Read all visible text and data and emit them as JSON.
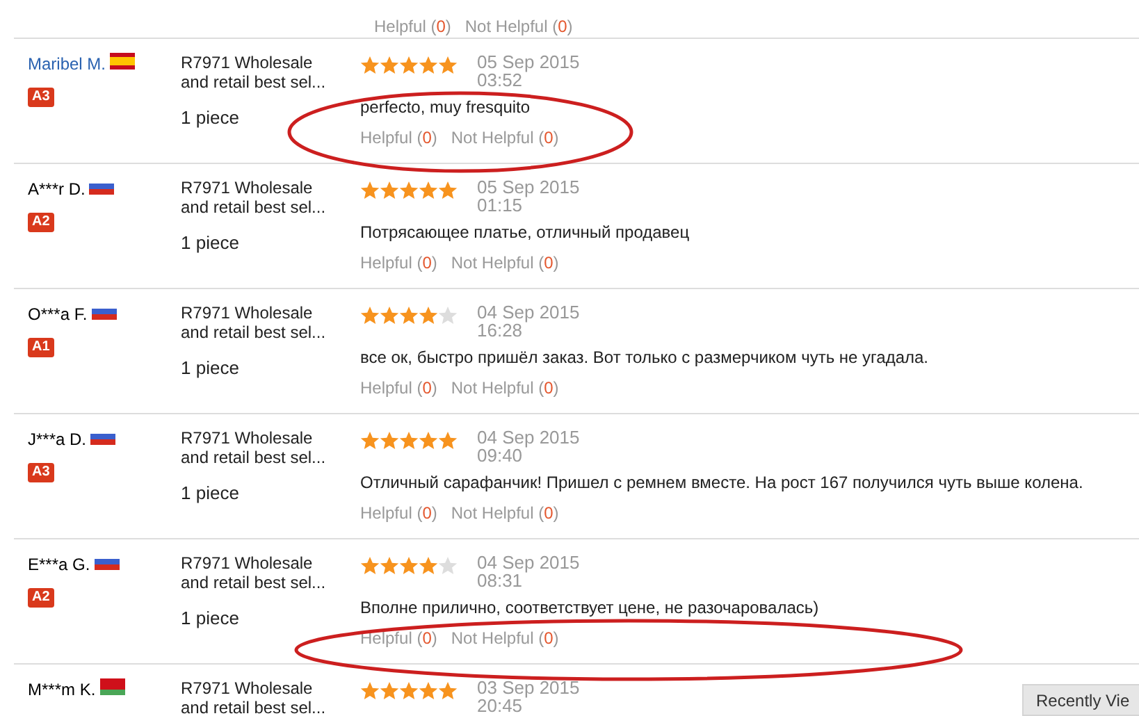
{
  "top_review": {
    "helpful": "Helpful",
    "helpful_count": "(0)",
    "not_helpful": "Not Helpful",
    "not_helpful_count": "(0)"
  },
  "reviews": [
    {
      "name": "Maribel M.",
      "kind": "link",
      "flag": {
        "kind": "es"
      },
      "badge": "A3",
      "product": "R7971 Wholesale and retail best sel...",
      "quantity": "1 piece",
      "stars": 5,
      "date": "05 Sep 2015",
      "time": "03:52",
      "text": "perfecto, muy fresquito",
      "helpful": "Helpful",
      "helpful_count": "(0)",
      "not_helpful": "Not Helpful",
      "not_helpful_count": "(0)",
      "circled": true
    },
    {
      "name": "A***r D.",
      "kind": "plain",
      "flag": {
        "kind": "ru"
      },
      "badge": "A2",
      "product": "R7971 Wholesale and retail best sel...",
      "quantity": "1 piece",
      "stars": 5,
      "date": "05 Sep 2015",
      "time": "01:15",
      "text": "Потрясающее платье, отличный продавец",
      "helpful": "Helpful",
      "helpful_count": "(0)",
      "not_helpful": "Not Helpful",
      "not_helpful_count": "(0)",
      "circled": false
    },
    {
      "name": "O***a F.",
      "kind": "plain",
      "flag": {
        "kind": "ru"
      },
      "badge": "A1",
      "product": "R7971 Wholesale and retail best sel...",
      "quantity": "1 piece",
      "stars": 4,
      "date": "04 Sep 2015",
      "time": "16:28",
      "text": "все ок, быстро пришёл заказ. Вот только с размерчиком чуть не угадала.",
      "helpful": "Helpful",
      "helpful_count": "(0)",
      "not_helpful": "Not Helpful",
      "not_helpful_count": "(0)",
      "circled": false
    },
    {
      "name": "J***a D.",
      "kind": "plain",
      "flag": {
        "kind": "ru"
      },
      "badge": "A3",
      "product": "R7971 Wholesale and retail best sel...",
      "quantity": "1 piece",
      "stars": 5,
      "date": "04 Sep 2015",
      "time": "09:40",
      "text": "Отличный сарафанчик! Пришел с ремнем вместе. На рост 167 получился чуть выше колена.",
      "helpful": "Helpful",
      "helpful_count": "(0)",
      "not_helpful": "Not Helpful",
      "not_helpful_count": "(0)",
      "circled": false
    },
    {
      "name": "E***a G.",
      "kind": "plain",
      "flag": {
        "kind": "ru"
      },
      "badge": "A2",
      "product": "R7971 Wholesale and retail best sel...",
      "quantity": "1 piece",
      "stars": 4,
      "date": "04 Sep 2015",
      "time": "08:31",
      "text": "Вполне прилично, соответствует цене, не разочаровалась)",
      "helpful": "Helpful",
      "helpful_count": "(0)",
      "not_helpful": "Not Helpful",
      "not_helpful_count": "(0)",
      "circled": true
    },
    {
      "name": "M***m K.",
      "kind": "plain",
      "flag": {
        "kind": "by"
      },
      "product": "R7971 Wholesale and retail best sel...",
      "stars": 5,
      "date": "03 Sep 2015",
      "time": "20:45",
      "circled": false
    }
  ],
  "recently_viewed_tab": "Recently Vie"
}
